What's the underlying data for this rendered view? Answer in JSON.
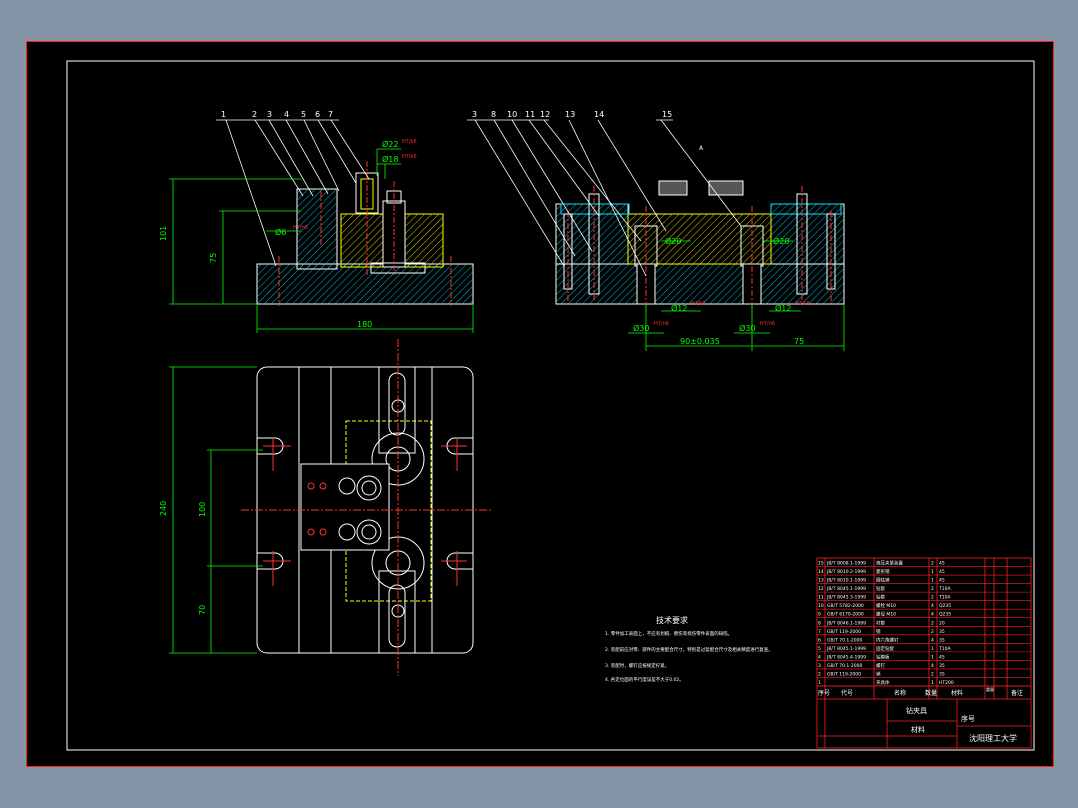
{
  "colors": {
    "background": "#8593a6",
    "sheet": "#000000",
    "frame": "#ff2020",
    "outline": "#ffffff",
    "dimension": "#00ff00",
    "hatch": "#00e5ff",
    "centerline": "#ff3030",
    "yellow": "#ffff00"
  },
  "front_view": {
    "callouts": [
      "1",
      "2",
      "3",
      "4",
      "5",
      "6",
      "7"
    ],
    "dims": {
      "height_total": "101",
      "height_body": "75",
      "width": "180",
      "hole_a": "Ø22",
      "hole_b": "Ø18",
      "hole_c": "Ø6"
    },
    "fit_tags": [
      "H7/k6",
      "H7/k6",
      "H7/n6"
    ]
  },
  "side_view": {
    "callouts": [
      "3",
      "8",
      "10",
      "11",
      "12",
      "13",
      "14",
      "15"
    ],
    "mark": "A",
    "dims": {
      "center_distance": "90±0.035",
      "offset": "75",
      "d30_left": "Ø30",
      "d30_right": "Ø30",
      "d12_left": "Ø12",
      "d12_right": "Ø12",
      "d20_left": "Ø20",
      "d20_right": "Ø20"
    },
    "fit_tags": [
      "H7/n6",
      "H7/n6",
      "H7/k6",
      "H7/k6"
    ]
  },
  "top_view": {
    "dims": {
      "overall": "240",
      "pitch": "100",
      "edge": "70"
    }
  },
  "tech_notes": {
    "title": "技术要求",
    "lines": [
      "1. 零件加工表面上，不应有划痕、擦伤等损伤零件表面的缺陷。",
      "2. 装配前应对零、部件的主要配合尺寸，特别是过盈配合尺寸及相关精度进行复查。",
      "3. 装配时，螺钉应按规定拧紧。",
      "4. 各定位面的平行度误差不大于0.02。"
    ]
  },
  "bom": {
    "rows": [
      {
        "no": "15",
        "code": "JB/T 8008.1-1999",
        "name": "液压夹紧装置",
        "qty": "2",
        "mat": "45"
      },
      {
        "no": "14",
        "code": "JB/T 8010.2-1999",
        "name": "菱形销",
        "qty": "1",
        "mat": "45"
      },
      {
        "no": "13",
        "code": "JB/T 8010.1-1999",
        "name": "圆柱销",
        "qty": "1",
        "mat": "45"
      },
      {
        "no": "12",
        "code": "JB/T 8045.1-1999",
        "name": "钻套",
        "qty": "2",
        "mat": "T10A"
      },
      {
        "no": "11",
        "code": "JB/T 8045.3-1999",
        "name": "钻套",
        "qty": "2",
        "mat": "T10A"
      },
      {
        "no": "10",
        "code": "GB/T 5782-2000",
        "name": "螺栓 M10",
        "qty": "4",
        "mat": "Q235"
      },
      {
        "no": "9",
        "code": "GB/T 6170-2000",
        "name": "螺母 M10",
        "qty": "4",
        "mat": "Q235"
      },
      {
        "no": "8",
        "code": "JB/T 8046.1-1999",
        "name": "衬套",
        "qty": "2",
        "mat": "20"
      },
      {
        "no": "7",
        "code": "GB/T 119-2000",
        "name": "销",
        "qty": "2",
        "mat": "35"
      },
      {
        "no": "6",
        "code": "GB/T 70.1-2000",
        "name": "内六角螺钉",
        "qty": "4",
        "mat": "35"
      },
      {
        "no": "5",
        "code": "JB/T 8045.1-1999",
        "name": "固定钻套",
        "qty": "1",
        "mat": "T10A"
      },
      {
        "no": "4",
        "code": "JB/T 8045.4-1999",
        "name": "钻模板",
        "qty": "1",
        "mat": "45"
      },
      {
        "no": "3",
        "code": "GB/T 70.1-2000",
        "name": "螺钉",
        "qty": "4",
        "mat": "35"
      },
      {
        "no": "2",
        "code": "GB/T 119-2000",
        "name": "销",
        "qty": "2",
        "mat": "35"
      },
      {
        "no": "1",
        "code": "",
        "name": "夹具体",
        "qty": "1",
        "mat": "HT200"
      }
    ],
    "header": {
      "no": "序号",
      "code": "代号",
      "name": "名称",
      "qty": "数量",
      "mat": "材料",
      "weight": "重量",
      "remark": "备注"
    }
  },
  "title_block": {
    "drawing_name": "钻夹具",
    "material_label": "材料",
    "seq_label": "序号",
    "school": "沈阳理工大学"
  }
}
